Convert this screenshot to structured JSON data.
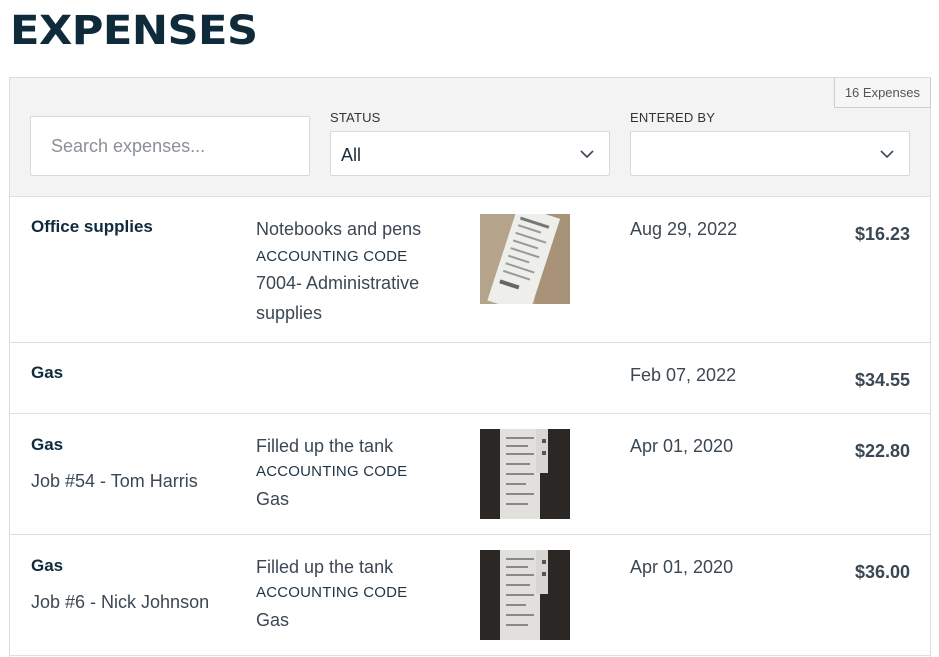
{
  "page": {
    "title": "EXPENSES"
  },
  "filters": {
    "count_label": "16 Expenses",
    "search_placeholder": "Search expenses...",
    "status_label": "STATUS",
    "status_value": "All",
    "entered_by_label": "ENTERED BY",
    "entered_by_value": ""
  },
  "code_label": "ACCOUNTING CODE",
  "expenses": [
    {
      "category": "Office supplies",
      "job": "",
      "description": "Notebooks and pens",
      "accounting_code": "7004- Administrative supplies",
      "date": "Aug 29, 2022",
      "amount": "$16.23",
      "receipt": "light-receipt"
    },
    {
      "category": "Gas",
      "job": "",
      "description": "",
      "accounting_code": "",
      "date": "Feb 07, 2022",
      "amount": "$34.55",
      "receipt": ""
    },
    {
      "category": "Gas",
      "job": "Job #54 - Tom Harris",
      "description": "Filled up the tank",
      "accounting_code": "Gas",
      "date": "Apr 01, 2020",
      "amount": "$22.80",
      "receipt": "dark-receipt"
    },
    {
      "category": "Gas",
      "job": "Job #6 - Nick Johnson",
      "description": "Filled up the tank",
      "accounting_code": "Gas",
      "date": "Apr 01, 2020",
      "amount": "$36.00",
      "receipt": "dark-receipt"
    }
  ],
  "colors": {
    "title": "#0f2a3a",
    "filter_bar": "#f3f3f3",
    "border": "#d9dde1"
  }
}
